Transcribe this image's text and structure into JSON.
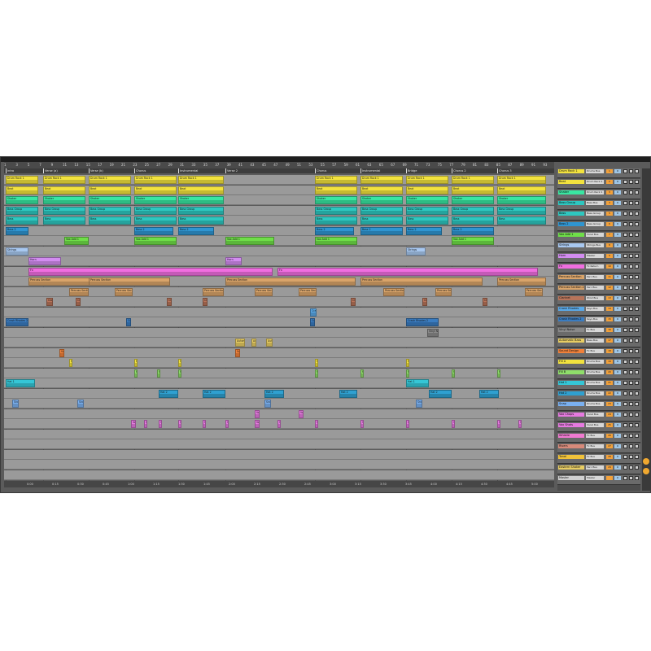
{
  "ruler": {
    "bars": [
      "1",
      "3",
      "5",
      "7",
      "9",
      "11",
      "13",
      "15",
      "17",
      "19",
      "21",
      "23",
      "25",
      "27",
      "29",
      "31",
      "33",
      "35",
      "37",
      "39",
      "41",
      "43",
      "45",
      "47",
      "49",
      "51",
      "53",
      "55",
      "57",
      "59",
      "61",
      "63",
      "65",
      "67",
      "69",
      "71",
      "73",
      "75",
      "77",
      "79",
      "81",
      "83",
      "85",
      "87",
      "89",
      "91",
      "93"
    ]
  },
  "locators": [
    "Intro",
    "Verse (a)",
    "Verse (b)",
    "Chorus",
    "Instrumental",
    "Verse 2",
    "Chorus",
    "Instrumental",
    "Bridge",
    "Chorus 2",
    "Chorus 3"
  ],
  "times": [
    "0:00",
    "0:15",
    "0:30",
    "0:45",
    "1:00",
    "1:15",
    "1:30",
    "1:45",
    "2:00",
    "2:15",
    "2:30",
    "2:45",
    "3:00",
    "3:15",
    "3:30",
    "3:45",
    "4:00",
    "4:15",
    "4:30",
    "4:45",
    "5:00"
  ],
  "tracks": [
    {
      "name": "Drum Rack 1",
      "route": "Drums Bus",
      "num": "1",
      "vol": "0",
      "color": "#f2e23e"
    },
    {
      "name": "Beat",
      "route": "Drum Rack 1",
      "num": "2",
      "vol": "0",
      "color": "#f2e23e"
    },
    {
      "name": "Shaker",
      "route": "Drum Rack 1",
      "num": "3",
      "vol": "0",
      "color": "#39e6a2"
    },
    {
      "name": "Bass Group",
      "route": "Bass Bus",
      "num": "4",
      "vol": "0",
      "color": "#2ec7c0"
    },
    {
      "name": "Bass",
      "route": "Bass Group",
      "num": "5",
      "vol": "0",
      "color": "#2ec7c0"
    },
    {
      "name": "Bass 2",
      "route": "Bass Group",
      "num": "6",
      "vol": "0",
      "color": "#2f95d1"
    },
    {
      "name": "Vox Add 1",
      "route": "Vocal Bus",
      "num": "7",
      "vol": "0",
      "color": "#6fde49"
    },
    {
      "name": "Strings",
      "route": "Strings Bus",
      "num": "8",
      "vol": "0",
      "color": "#a8c8f0"
    },
    {
      "name": "Horn",
      "route": "Master",
      "num": "9",
      "vol": "0",
      "color": "#d28cf0"
    },
    {
      "name": "Fx",
      "route": "Fx Return",
      "num": "10",
      "vol": "0",
      "color": "#f06ee0"
    },
    {
      "name": "Percuss Section",
      "route": "Perc Bus",
      "num": "11",
      "vol": "0",
      "color": "#d9a46a"
    },
    {
      "name": "Percuss Section 2",
      "route": "Perc Bus",
      "num": "12",
      "vol": "0",
      "color": "#d9a46a"
    },
    {
      "name": "Clarinet",
      "route": "Wind Bus",
      "num": "13",
      "vol": "0",
      "color": "#b8745a"
    },
    {
      "name": "Crash Rhodes",
      "route": "Keys Bus",
      "num": "14",
      "vol": "0",
      "color": "#5aa8e6"
    },
    {
      "name": "Crash Rhodes 2",
      "route": "Keys Bus",
      "num": "15",
      "vol": "0",
      "color": "#3a7cc0"
    },
    {
      "name": "Vinyl Noise",
      "route": "Fx Bus",
      "num": "16",
      "vol": "0",
      "color": "#8a8a8a"
    },
    {
      "name": "Automatic Bass",
      "route": "Bass Bus",
      "num": "17",
      "vol": "0",
      "color": "#e8cd63"
    },
    {
      "name": "Sound Design",
      "route": "Fx Bus",
      "num": "18",
      "vol": "0",
      "color": "#f0813a"
    },
    {
      "name": "Fill A",
      "route": "Drums Bus",
      "num": "19",
      "vol": "0",
      "color": "#f2e23e"
    },
    {
      "name": "Fill B",
      "route": "Drums Bus",
      "num": "20",
      "vol": "0",
      "color": "#8fde6a"
    },
    {
      "name": "Hat 1",
      "route": "Drums Bus",
      "num": "21",
      "vol": "0",
      "color": "#35c6d6"
    },
    {
      "name": "Hat 2",
      "route": "Drums Bus",
      "num": "22",
      "vol": "0",
      "color": "#2fa0d0"
    },
    {
      "name": "Snap",
      "route": "Drums Bus",
      "num": "23",
      "vol": "0",
      "color": "#7ab0f0"
    },
    {
      "name": "Vox Chops",
      "route": "Vocal Bus",
      "num": "24",
      "vol": "0",
      "color": "#e67ae0"
    },
    {
      "name": "Vox Shots",
      "route": "Vocal Bus",
      "num": "25",
      "vol": "0",
      "color": "#e67ae0"
    },
    {
      "name": "Whistle",
      "route": "Fx Bus",
      "num": "26",
      "vol": "0",
      "color": "#f07ad0"
    },
    {
      "name": "Risers",
      "route": "Fx Bus",
      "num": "27",
      "vol": "0",
      "color": "#d88a7a"
    },
    {
      "name": "Tonal",
      "route": "Fx Bus",
      "num": "28",
      "vol": "0",
      "color": "#f0c23a"
    },
    {
      "name": "Eastern Shaker",
      "route": "Perc Bus",
      "num": "29",
      "vol": "0",
      "color": "#e8cd63"
    },
    {
      "name": "Master",
      "route": "Master",
      "num": "",
      "vol": "0",
      "color": "#cfcfcf"
    }
  ],
  "colors": {
    "background": "#5b5b5b",
    "lane": "#9a9a9a",
    "accent": "#f0a830"
  }
}
